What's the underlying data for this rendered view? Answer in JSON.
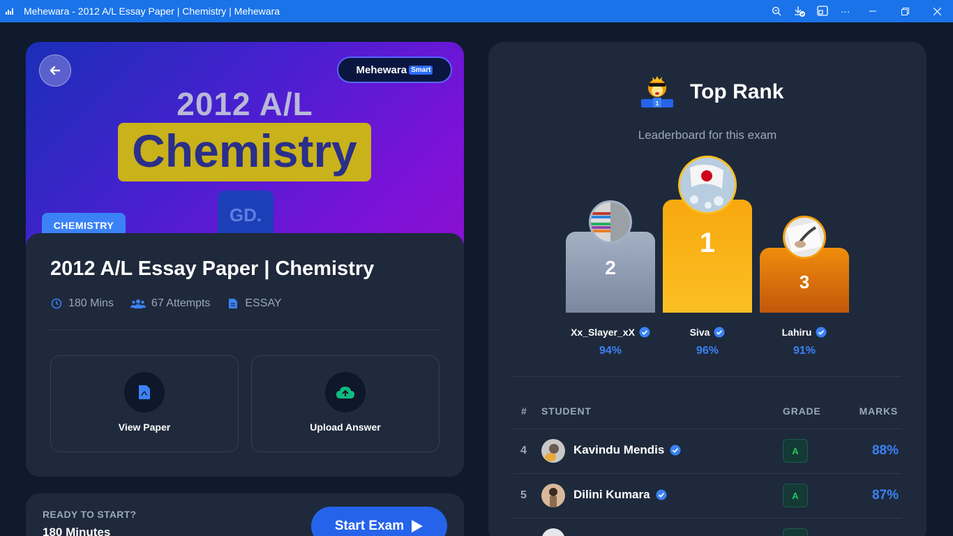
{
  "window": {
    "title": "Mehewara - 2012 A/L Essay Paper | Chemistry | Mehewara"
  },
  "banner": {
    "brand": "Mehewara",
    "brand_tag": "Smart",
    "year_line": "2012 A/L",
    "subject_line": "Chemistry",
    "logo_text": "GD.",
    "subject_tag": "CHEMISTRY"
  },
  "paper": {
    "title": "2012 A/L Essay Paper | Chemistry",
    "duration": "180 Mins",
    "attempts": "67 Attempts",
    "type": "ESSAY"
  },
  "actions": {
    "view_paper": "View Paper",
    "upload_answer": "Upload Answer"
  },
  "start": {
    "ready_label": "READY TO START?",
    "minutes": "180 Minutes",
    "button": "Start Exam"
  },
  "leaderboard": {
    "title": "Top Rank",
    "subtitle": "Leaderboard for this exam",
    "podium": [
      {
        "rank": "2",
        "name": "Xx_Slayer_xX",
        "percent": "94%"
      },
      {
        "rank": "1",
        "name": "Siva",
        "percent": "96%"
      },
      {
        "rank": "3",
        "name": "Lahiru",
        "percent": "91%"
      }
    ],
    "columns": {
      "rank": "#",
      "student": "STUDENT",
      "grade": "GRADE",
      "marks": "MARKS"
    },
    "rows": [
      {
        "rank": "4",
        "name": "Kavindu Mendis",
        "grade": "A",
        "marks": "88%"
      },
      {
        "rank": "5",
        "name": "Dilini Kumara",
        "grade": "A",
        "marks": "87%"
      }
    ]
  },
  "colors": {
    "accent": "#3b82f6",
    "titlebar": "#1a73e8",
    "gold": "#f5b014",
    "silver": "#94a3b8",
    "bronze": "#d97706",
    "grade_green": "#22c55e"
  }
}
